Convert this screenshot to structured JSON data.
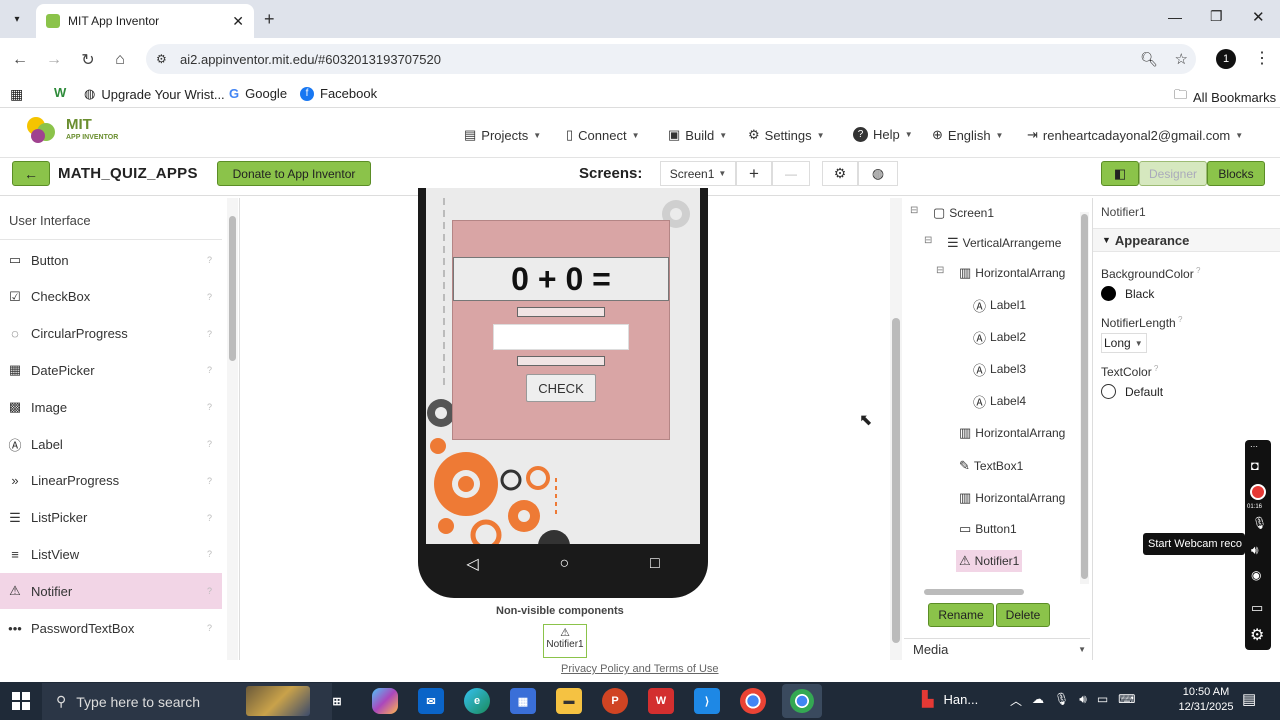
{
  "browser": {
    "tab_title": "MIT App Inventor",
    "url": "ai2.appinventor.mit.edu/#6032013193707520",
    "bookmarks": [
      "Upgrade Your Wrist...",
      "Google",
      "Facebook"
    ],
    "all_bookmarks": "All Bookmarks",
    "profile_initial": "1"
  },
  "app_menu": {
    "logo_line1": "MIT",
    "logo_line2": "APP INVENTOR",
    "projects": "Projects",
    "connect": "Connect",
    "build": "Build",
    "settings": "Settings",
    "help": "Help",
    "language": "English",
    "account": "renheartcadayonal2@gmail.com"
  },
  "project_bar": {
    "project_name": "MATH_QUIZ_APPS",
    "donate": "Donate to App Inventor",
    "screens_label": "Screens:",
    "screen_select": "Screen1",
    "add_screen": "+",
    "remove_screen": "—",
    "designer": "Designer",
    "blocks": "Blocks"
  },
  "palette": {
    "header": "User Interface",
    "items": [
      {
        "label": "Button",
        "icon": "button-icon"
      },
      {
        "label": "CheckBox",
        "icon": "checkbox-icon"
      },
      {
        "label": "CircularProgress",
        "icon": "circular-progress-icon"
      },
      {
        "label": "DatePicker",
        "icon": "calendar-icon"
      },
      {
        "label": "Image",
        "icon": "image-icon"
      },
      {
        "label": "Label",
        "icon": "label-icon"
      },
      {
        "label": "LinearProgress",
        "icon": "linear-progress-icon"
      },
      {
        "label": "ListPicker",
        "icon": "list-picker-icon"
      },
      {
        "label": "ListView",
        "icon": "list-view-icon"
      },
      {
        "label": "Notifier",
        "icon": "warning-icon"
      },
      {
        "label": "PasswordTextBox",
        "icon": "password-icon"
      }
    ],
    "selected": "Notifier",
    "help_glyph": "?"
  },
  "viewer": {
    "equation": "0 + 0 =",
    "check_button": "CHECK",
    "non_visible_label": "Non-visible components",
    "non_visible_item": "Notifier1",
    "footer": "Privacy Policy and Terms of Use"
  },
  "tree": {
    "nodes": [
      {
        "label": "Screen1",
        "icon": "screen-icon"
      },
      {
        "label": "VerticalArrangeme",
        "icon": "vertical-arrangement-icon"
      },
      {
        "label": "HorizontalArrang",
        "icon": "horizontal-arrangement-icon"
      },
      {
        "label": "Label1",
        "icon": "label-icon"
      },
      {
        "label": "Label2",
        "icon": "label-icon"
      },
      {
        "label": "Label3",
        "icon": "label-icon"
      },
      {
        "label": "Label4",
        "icon": "label-icon"
      },
      {
        "label": "HorizontalArrang",
        "icon": "horizontal-arrangement-icon"
      },
      {
        "label": "TextBox1",
        "icon": "textbox-icon"
      },
      {
        "label": "HorizontalArrang",
        "icon": "horizontal-arrangement-icon"
      },
      {
        "label": "Button1",
        "icon": "button-icon"
      },
      {
        "label": "Notifier1",
        "icon": "warning-icon"
      }
    ],
    "selected": "Notifier1",
    "rename": "Rename",
    "delete": "Delete",
    "media": "Media"
  },
  "properties": {
    "component": "Notifier1",
    "section": "Appearance",
    "background_color_label": "BackgroundColor",
    "background_color_value": "Black",
    "notifier_length_label": "NotifierLength",
    "notifier_length_value": "Long",
    "text_color_label": "TextColor",
    "text_color_value": "Default"
  },
  "recorder": {
    "time": "01:16",
    "tooltip": "Start Webcam reco"
  },
  "taskbar": {
    "search_placeholder": "Type here to search",
    "app_label": "Han...",
    "time": "10:50 AM",
    "date": "12/31/2025"
  },
  "colors": {
    "accent_green": "#8bc34a",
    "selected_pink": "#f2d5e6",
    "phone_screen_pink": "#d9a5a5",
    "gear_orange": "#ee7a35",
    "taskbar": "#1f2a38"
  }
}
